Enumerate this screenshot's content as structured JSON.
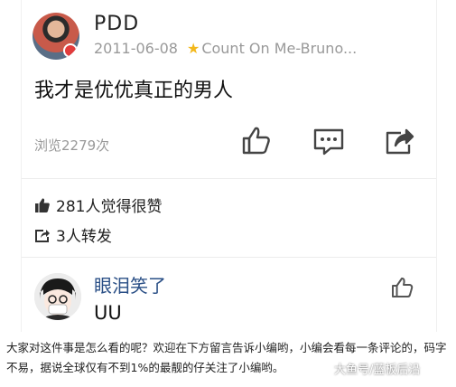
{
  "post": {
    "username": "PDD",
    "date": "2011-06-08",
    "source": "Count On Me-Bruno...",
    "text": "我才是优优真正的男人",
    "views": "浏览2279次"
  },
  "stats": {
    "likes": "281人觉得很赞",
    "reposts": "3人转发"
  },
  "comment": {
    "name": "眼泪笑了",
    "text": "UU"
  },
  "caption": "大家对这件事是怎么看的呢？欢迎在下方留言告诉小编哟，小编会看每一条评论的，码字不易，据说全球仅有不到1%的最靓的仔关注了小编哟。",
  "watermark": "大鱼号/蓝板后沿",
  "colors": {
    "accent_star": "#f3b81b",
    "comment_name": "#2a4f86",
    "text_muted": "#999999"
  }
}
